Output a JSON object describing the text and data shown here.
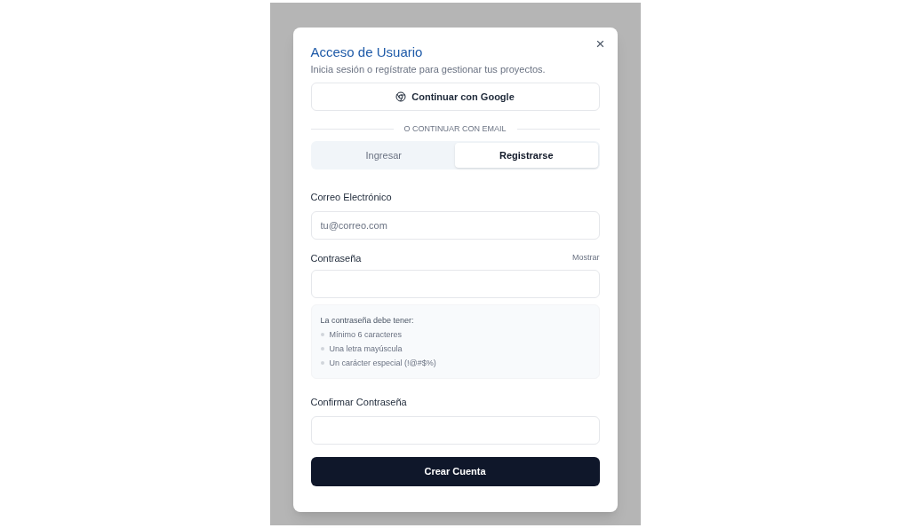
{
  "dialog": {
    "title": "Acceso de Usuario",
    "subtitle": "Inicia sesión o regístrate para gestionar tus proyectos.",
    "close": "×"
  },
  "google_button": "Continuar con Google",
  "divider": "O CONTINUAR CON EMAIL",
  "tabs": [
    {
      "label": "Ingresar",
      "selected": false
    },
    {
      "label": "Registrarse",
      "selected": true
    }
  ],
  "email": {
    "label": "Correo Electrónico",
    "placeholder": "tu@correo.com"
  },
  "password": {
    "label": "Contraseña",
    "toggle": "Mostrar"
  },
  "rules": {
    "title": "La contraseña debe tener:",
    "items": [
      {
        "text": "Mínimo 6 caracteres",
        "met": false
      },
      {
        "text": "Una letra mayúscula",
        "met": false
      },
      {
        "text": "Un carácter especial (!@#$%)",
        "met": false
      }
    ]
  },
  "confirm": {
    "label": "Confirmar Contraseña"
  },
  "submit": "Crear Cuenta"
}
